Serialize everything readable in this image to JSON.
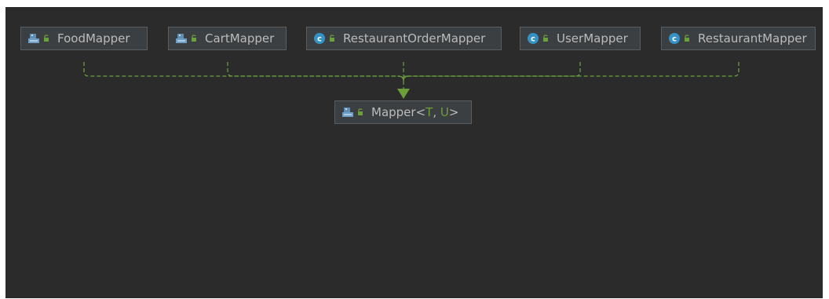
{
  "diagram": {
    "colors": {
      "canvas_background": "#2b2b2b",
      "node_background": "#3c3f41",
      "node_border": "#5a5d5f",
      "node_text": "#bbbbbb",
      "edge": "#6a9f3a",
      "type_parameter": "#6a9f3a",
      "class_icon": "#3592c4"
    },
    "nodes": [
      {
        "id": "FoodMapper",
        "label": "FoodMapper",
        "icon": "interface-icon"
      },
      {
        "id": "CartMapper",
        "label": "CartMapper",
        "icon": "interface-icon"
      },
      {
        "id": "RestaurantOrderMapper",
        "label": "RestaurantOrderMapper",
        "icon": "class-icon"
      },
      {
        "id": "UserMapper",
        "label": "UserMapper",
        "icon": "class-icon"
      },
      {
        "id": "RestaurantMapper",
        "label": "RestaurantMapper",
        "icon": "class-icon"
      }
    ],
    "target": {
      "id": "Mapper",
      "label": "Mapper",
      "type_params": [
        "T",
        "U"
      ],
      "icon": "interface-icon"
    },
    "edges": [
      {
        "from": "FoodMapper",
        "to": "Mapper",
        "style": "dashed"
      },
      {
        "from": "CartMapper",
        "to": "Mapper",
        "style": "dashed"
      },
      {
        "from": "RestaurantOrderMapper",
        "to": "Mapper",
        "style": "dashed"
      },
      {
        "from": "UserMapper",
        "to": "Mapper",
        "style": "dashed"
      },
      {
        "from": "RestaurantMapper",
        "to": "Mapper",
        "style": "dashed"
      }
    ]
  }
}
